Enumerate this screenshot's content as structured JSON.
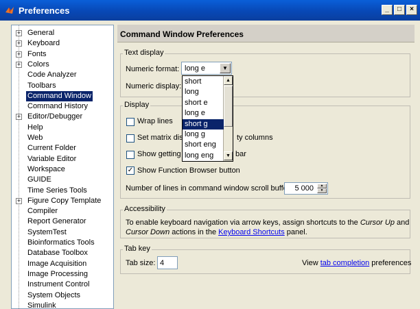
{
  "window": {
    "title": "Preferences",
    "btn_min": "_",
    "btn_max": "□",
    "btn_close": "×"
  },
  "tree": {
    "items": [
      {
        "label": "General",
        "expandable": true
      },
      {
        "label": "Keyboard",
        "expandable": true
      },
      {
        "label": "Fonts",
        "expandable": true
      },
      {
        "label": "Colors",
        "expandable": true
      },
      {
        "label": "Code Analyzer",
        "expandable": false
      },
      {
        "label": "Toolbars",
        "expandable": false
      },
      {
        "label": "Command Window",
        "expandable": false,
        "selected": true
      },
      {
        "label": "Command History",
        "expandable": false
      },
      {
        "label": "Editor/Debugger",
        "expandable": true
      },
      {
        "label": "Help",
        "expandable": false
      },
      {
        "label": "Web",
        "expandable": false
      },
      {
        "label": "Current Folder",
        "expandable": false
      },
      {
        "label": "Variable Editor",
        "expandable": false
      },
      {
        "label": "Workspace",
        "expandable": false
      },
      {
        "label": "GUIDE",
        "expandable": false
      },
      {
        "label": "Time Series Tools",
        "expandable": false
      },
      {
        "label": "Figure Copy Template",
        "expandable": true
      },
      {
        "label": "Compiler",
        "expandable": false
      },
      {
        "label": "Report Generator",
        "expandable": false
      },
      {
        "label": "SystemTest",
        "expandable": false
      },
      {
        "label": "Bioinformatics Tools",
        "expandable": false
      },
      {
        "label": "Database Toolbox",
        "expandable": false
      },
      {
        "label": "Image Acquisition",
        "expandable": false
      },
      {
        "label": "Image Processing",
        "expandable": false
      },
      {
        "label": "Instrument Control",
        "expandable": false
      },
      {
        "label": "System Objects",
        "expandable": false
      },
      {
        "label": "Simulink",
        "expandable": false
      }
    ]
  },
  "panel": {
    "header": "Command Window Preferences",
    "text_display": {
      "title": "Text display",
      "numeric_format_label": "Numeric format:",
      "numeric_format_value": "long e",
      "numeric_display_label": "Numeric display:"
    },
    "dropdown": {
      "options": [
        "short",
        "long",
        "short e",
        "long e",
        "short g",
        "long g",
        "short eng",
        "long eng"
      ],
      "highlighted": "short g"
    },
    "display": {
      "title": "Display",
      "wrap_lines": "Wrap lines",
      "set_matrix": "Set matrix disp",
      "set_matrix_tail": "ty columns",
      "show_getting": "Show getting",
      "show_getting_tail": "bar",
      "show_function_browser": "Show Function Browser button",
      "scroll_buffer_label": "Number of lines in command window scroll buffer:",
      "scroll_buffer_value": "5 000",
      "check_mark": "✓"
    },
    "accessibility": {
      "title": "Accessibility",
      "line1_prefix": "To enable keyboard navigation via arrow keys, assign shortcuts to the ",
      "line1_italic": "Cursor Up",
      "line1_suffix": " and",
      "line2_italic": "Cursor Down",
      "line2_mid": " actions in the ",
      "line2_link": "Keyboard Shortcuts",
      "line2_suffix": " panel."
    },
    "tab_key": {
      "title": "Tab key",
      "tab_size_label": "Tab size:",
      "tab_size_value": "4",
      "view_prefix": "View ",
      "view_link": "tab completion",
      "view_suffix": " preferences"
    }
  }
}
